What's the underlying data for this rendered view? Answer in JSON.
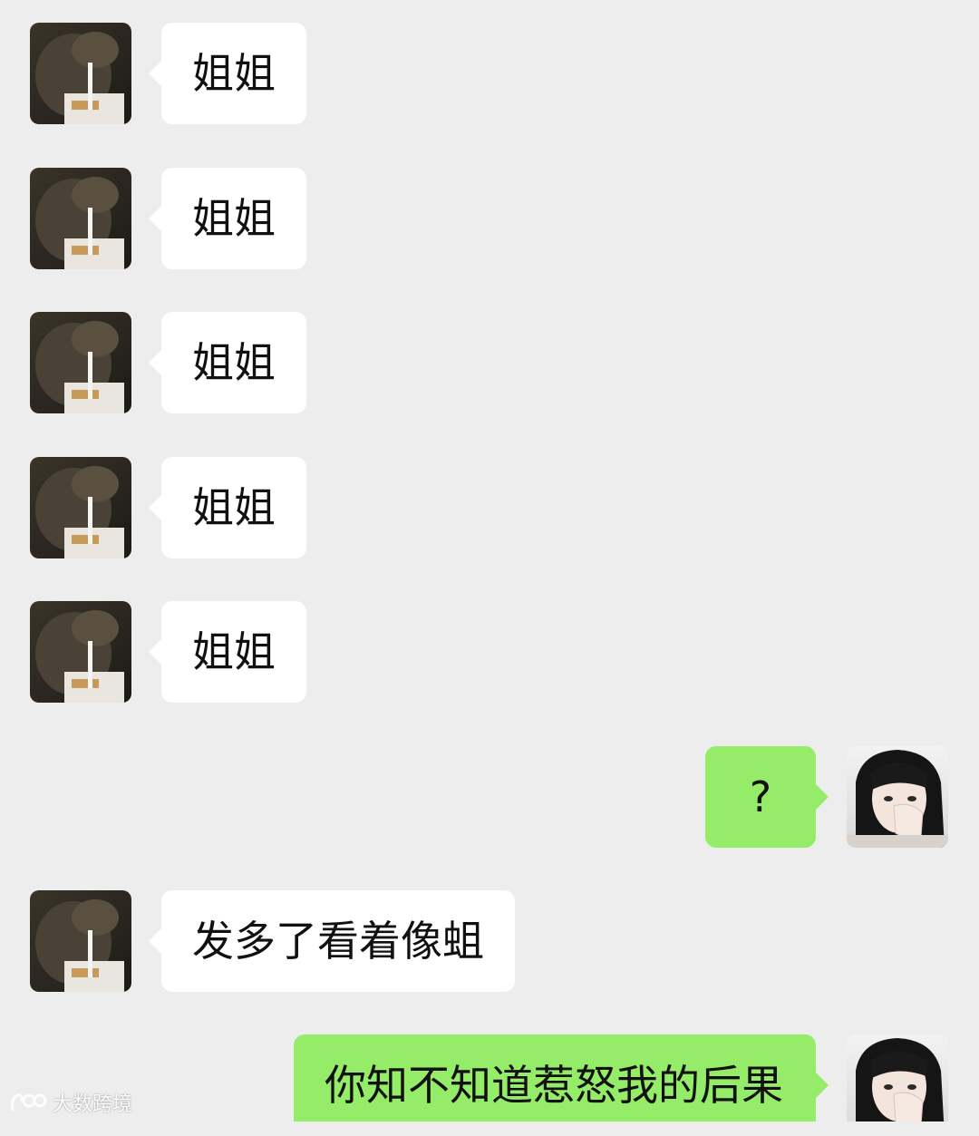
{
  "messages": [
    {
      "side": "in",
      "text": "姐姐"
    },
    {
      "side": "in",
      "text": "姐姐"
    },
    {
      "side": "in",
      "text": "姐姐"
    },
    {
      "side": "in",
      "text": "姐姐"
    },
    {
      "side": "in",
      "text": "姐姐"
    },
    {
      "side": "out",
      "text": "?"
    },
    {
      "side": "in",
      "text": "发多了看着像蛆"
    },
    {
      "side": "out",
      "text": "你知不知道惹怒我的后果"
    }
  ],
  "watermark": {
    "text": "大数跨境"
  },
  "colors": {
    "background": "#ededed",
    "incoming_bubble": "#ffffff",
    "outgoing_bubble": "#95ec69"
  }
}
